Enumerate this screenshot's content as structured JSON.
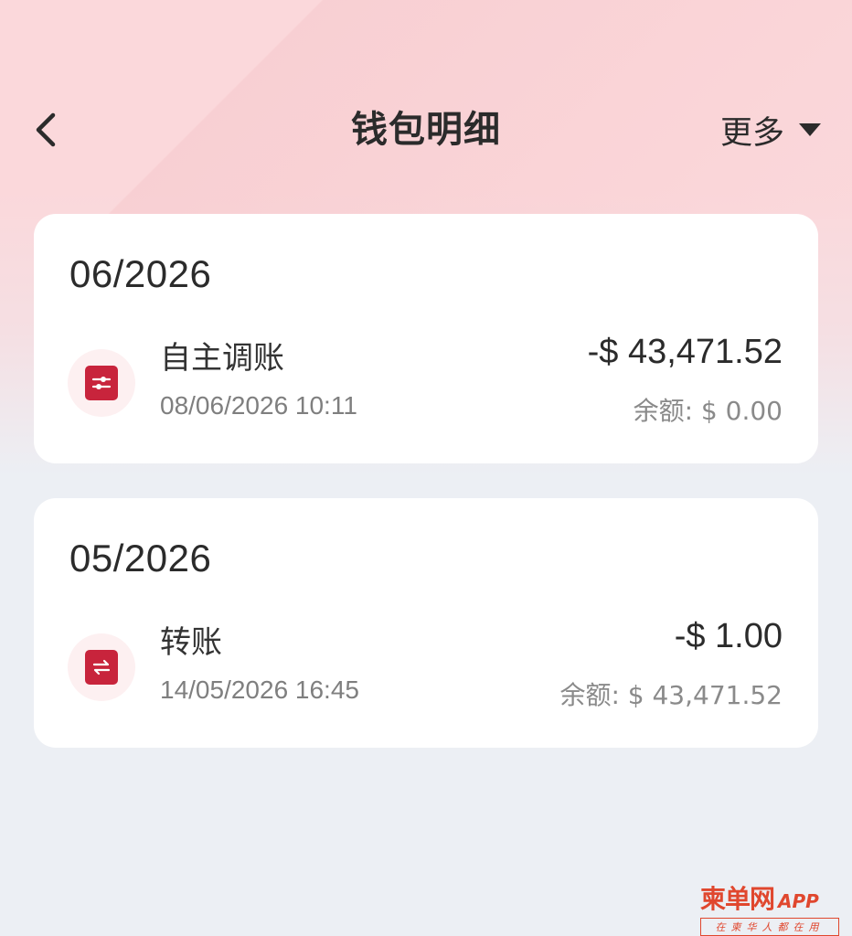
{
  "header": {
    "title": "钱包明细",
    "more_label": "更多"
  },
  "months": [
    {
      "label": "06/2026",
      "transactions": [
        {
          "name": "自主调账",
          "time": "08/06/2026 10:11",
          "amount": "-$ 43,471.52",
          "balance": "余额: $ 0.00",
          "icon": "adjust-icon"
        }
      ]
    },
    {
      "label": "05/2026",
      "transactions": [
        {
          "name": "转账",
          "time": "14/05/2026 16:45",
          "amount": "-$ 1.00",
          "balance": "余额: $ 43,471.52",
          "icon": "transfer-icon"
        }
      ]
    }
  ],
  "watermark": {
    "brand": "柬单网",
    "app": "APP",
    "slogan": "在柬华人都在用"
  },
  "colors": {
    "accent": "#c8243c",
    "background": "#eceff4",
    "header_pink": "#fbd8db",
    "watermark": "#e0472e"
  }
}
